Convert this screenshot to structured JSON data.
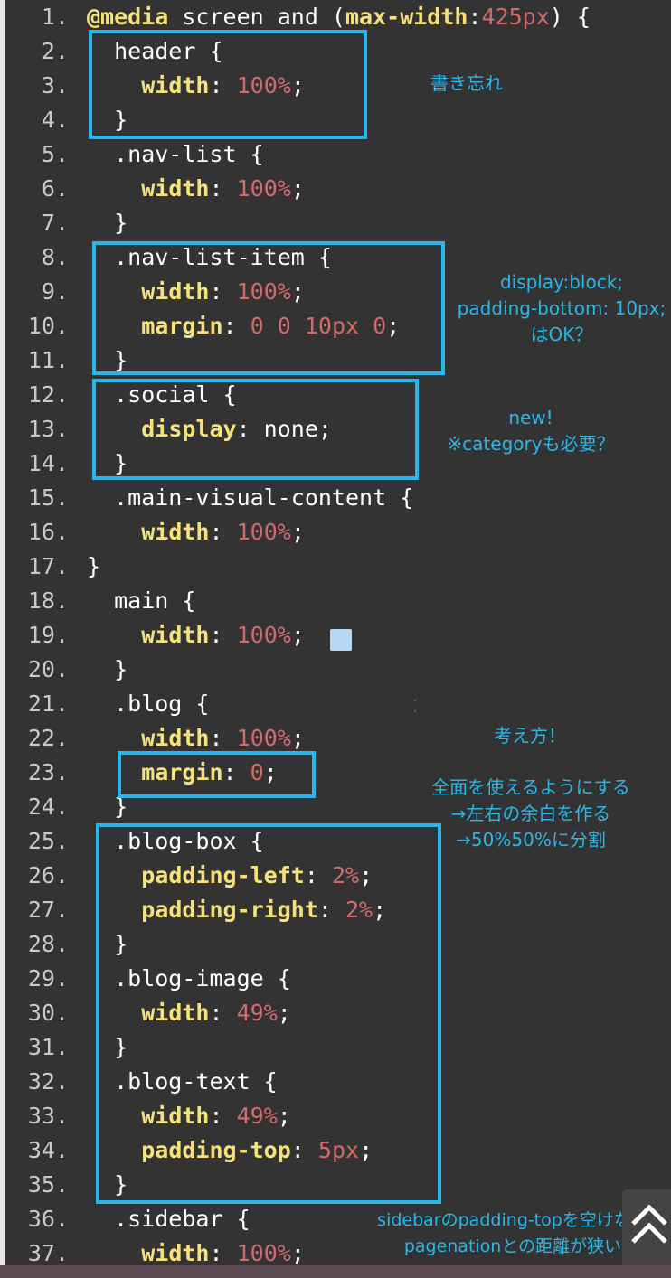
{
  "code_lines": [
    {
      "n": "1.",
      "tokens": [
        {
          "t": "@media",
          "c": "tok-at"
        },
        {
          "t": " screen and (",
          "c": "tok-pl"
        },
        {
          "t": "max-width",
          "c": "tok-kw"
        },
        {
          "t": ":",
          "c": "tok-pl"
        },
        {
          "t": "425px",
          "c": "tok-num"
        },
        {
          "t": ") {",
          "c": "tok-pl"
        }
      ]
    },
    {
      "n": "2.",
      "tokens": [
        {
          "t": "  header {",
          "c": "tok-pl"
        }
      ]
    },
    {
      "n": "3.",
      "tokens": [
        {
          "t": "    ",
          "c": "tok-pl"
        },
        {
          "t": "width",
          "c": "tok-kw"
        },
        {
          "t": ": ",
          "c": "tok-pl"
        },
        {
          "t": "100%",
          "c": "tok-num"
        },
        {
          "t": ";",
          "c": "tok-pl"
        }
      ]
    },
    {
      "n": "4.",
      "tokens": [
        {
          "t": "  }",
          "c": "tok-pl"
        }
      ]
    },
    {
      "n": "5.",
      "tokens": [
        {
          "t": "  .nav-list {",
          "c": "tok-pl"
        }
      ]
    },
    {
      "n": "6.",
      "tokens": [
        {
          "t": "    ",
          "c": "tok-pl"
        },
        {
          "t": "width",
          "c": "tok-kw"
        },
        {
          "t": ": ",
          "c": "tok-pl"
        },
        {
          "t": "100%",
          "c": "tok-num"
        },
        {
          "t": ";",
          "c": "tok-pl"
        }
      ]
    },
    {
      "n": "7.",
      "tokens": [
        {
          "t": "  }",
          "c": "tok-pl"
        }
      ]
    },
    {
      "n": "8.",
      "tokens": [
        {
          "t": "  .nav-list-item {",
          "c": "tok-pl"
        }
      ]
    },
    {
      "n": "9.",
      "tokens": [
        {
          "t": "    ",
          "c": "tok-pl"
        },
        {
          "t": "width",
          "c": "tok-kw"
        },
        {
          "t": ": ",
          "c": "tok-pl"
        },
        {
          "t": "100%",
          "c": "tok-num"
        },
        {
          "t": ";",
          "c": "tok-pl"
        }
      ]
    },
    {
      "n": "10.",
      "tokens": [
        {
          "t": "    ",
          "c": "tok-pl"
        },
        {
          "t": "margin",
          "c": "tok-kw"
        },
        {
          "t": ": ",
          "c": "tok-pl"
        },
        {
          "t": "0 0 10px 0",
          "c": "tok-num"
        },
        {
          "t": ";",
          "c": "tok-pl"
        }
      ]
    },
    {
      "n": "11.",
      "tokens": [
        {
          "t": "  }",
          "c": "tok-pl"
        }
      ]
    },
    {
      "n": "12.",
      "tokens": [
        {
          "t": "  .social {",
          "c": "tok-pl"
        }
      ]
    },
    {
      "n": "13.",
      "tokens": [
        {
          "t": "    ",
          "c": "tok-pl"
        },
        {
          "t": "display",
          "c": "tok-kw"
        },
        {
          "t": ": none;",
          "c": "tok-pl"
        }
      ]
    },
    {
      "n": "14.",
      "tokens": [
        {
          "t": "  }",
          "c": "tok-pl"
        }
      ]
    },
    {
      "n": "15.",
      "tokens": [
        {
          "t": "  .main-visual-content {",
          "c": "tok-pl"
        }
      ]
    },
    {
      "n": "16.",
      "tokens": [
        {
          "t": "    ",
          "c": "tok-pl"
        },
        {
          "t": "width",
          "c": "tok-kw"
        },
        {
          "t": ": ",
          "c": "tok-pl"
        },
        {
          "t": "100%",
          "c": "tok-num"
        },
        {
          "t": ";",
          "c": "tok-pl"
        }
      ]
    },
    {
      "n": "17.",
      "tokens": [
        {
          "t": "}",
          "c": "tok-pl"
        }
      ]
    },
    {
      "n": "18.",
      "tokens": [
        {
          "t": "  main {",
          "c": "tok-pl"
        }
      ]
    },
    {
      "n": "19.",
      "tokens": [
        {
          "t": "    ",
          "c": "tok-pl"
        },
        {
          "t": "width",
          "c": "tok-kw"
        },
        {
          "t": ": ",
          "c": "tok-pl"
        },
        {
          "t": "100%",
          "c": "tok-num"
        },
        {
          "t": ";",
          "c": "tok-pl"
        }
      ]
    },
    {
      "n": "20.",
      "tokens": [
        {
          "t": "  }",
          "c": "tok-pl"
        }
      ]
    },
    {
      "n": "21.",
      "tokens": [
        {
          "t": "  .blog {",
          "c": "tok-pl"
        }
      ]
    },
    {
      "n": "22.",
      "tokens": [
        {
          "t": "    ",
          "c": "tok-pl"
        },
        {
          "t": "width",
          "c": "tok-kw"
        },
        {
          "t": ": ",
          "c": "tok-pl"
        },
        {
          "t": "100%",
          "c": "tok-num"
        },
        {
          "t": ";",
          "c": "tok-pl"
        }
      ]
    },
    {
      "n": "23.",
      "tokens": [
        {
          "t": "    ",
          "c": "tok-pl"
        },
        {
          "t": "margin",
          "c": "tok-kw"
        },
        {
          "t": ": ",
          "c": "tok-pl"
        },
        {
          "t": "0",
          "c": "tok-num"
        },
        {
          "t": ";",
          "c": "tok-pl"
        }
      ]
    },
    {
      "n": "24.",
      "tokens": [
        {
          "t": "  }",
          "c": "tok-pl"
        }
      ]
    },
    {
      "n": "25.",
      "tokens": [
        {
          "t": "  .blog-box {",
          "c": "tok-pl"
        }
      ]
    },
    {
      "n": "26.",
      "tokens": [
        {
          "t": "    ",
          "c": "tok-pl"
        },
        {
          "t": "padding-left",
          "c": "tok-kw"
        },
        {
          "t": ": ",
          "c": "tok-pl"
        },
        {
          "t": "2%",
          "c": "tok-num"
        },
        {
          "t": ";",
          "c": "tok-pl"
        }
      ]
    },
    {
      "n": "27.",
      "tokens": [
        {
          "t": "    ",
          "c": "tok-pl"
        },
        {
          "t": "padding-right",
          "c": "tok-kw"
        },
        {
          "t": ": ",
          "c": "tok-pl"
        },
        {
          "t": "2%",
          "c": "tok-num"
        },
        {
          "t": ";",
          "c": "tok-pl"
        }
      ]
    },
    {
      "n": "28.",
      "tokens": [
        {
          "t": "  }",
          "c": "tok-pl"
        }
      ]
    },
    {
      "n": "29.",
      "tokens": [
        {
          "t": "  .blog-image {",
          "c": "tok-pl"
        }
      ]
    },
    {
      "n": "30.",
      "tokens": [
        {
          "t": "    ",
          "c": "tok-pl"
        },
        {
          "t": "width",
          "c": "tok-kw"
        },
        {
          "t": ": ",
          "c": "tok-pl"
        },
        {
          "t": "49%",
          "c": "tok-num"
        },
        {
          "t": ";",
          "c": "tok-pl"
        }
      ]
    },
    {
      "n": "31.",
      "tokens": [
        {
          "t": "  }",
          "c": "tok-pl"
        }
      ]
    },
    {
      "n": "32.",
      "tokens": [
        {
          "t": "  .blog-text {",
          "c": "tok-pl"
        }
      ]
    },
    {
      "n": "33.",
      "tokens": [
        {
          "t": "    ",
          "c": "tok-pl"
        },
        {
          "t": "width",
          "c": "tok-kw"
        },
        {
          "t": ": ",
          "c": "tok-pl"
        },
        {
          "t": "49%",
          "c": "tok-num"
        },
        {
          "t": ";",
          "c": "tok-pl"
        }
      ]
    },
    {
      "n": "34.",
      "tokens": [
        {
          "t": "    ",
          "c": "tok-pl"
        },
        {
          "t": "padding-top",
          "c": "tok-kw"
        },
        {
          "t": ": ",
          "c": "tok-pl"
        },
        {
          "t": "5px",
          "c": "tok-num"
        },
        {
          "t": ";",
          "c": "tok-pl"
        }
      ]
    },
    {
      "n": "35.",
      "tokens": [
        {
          "t": "  }",
          "c": "tok-pl"
        }
      ]
    },
    {
      "n": "36.",
      "tokens": [
        {
          "t": "  .sidebar {",
          "c": "tok-pl"
        }
      ]
    },
    {
      "n": "37.",
      "tokens": [
        {
          "t": "    ",
          "c": "tok-pl"
        },
        {
          "t": "width",
          "c": "tok-kw"
        },
        {
          "t": ": ",
          "c": "tok-pl"
        },
        {
          "t": "100%",
          "c": "tok-num"
        },
        {
          "t": ";",
          "c": "tok-pl"
        }
      ]
    }
  ],
  "annotations": {
    "note_header": "書き忘れ",
    "note_nav_item_1": "display:block;",
    "note_nav_item_2": "padding-bottom: 10px;",
    "note_nav_item_3": "はOK？",
    "note_social_1": "new!",
    "note_social_2": "※categoryも必要？",
    "note_blog": "考え方！",
    "note_blogbox_1": "全面を使えるようにする",
    "note_blogbox_2": "→左右の余白を作る",
    "note_blogbox_3": "→50%50%に分割",
    "note_sidebar_1": "sidebarのpadding-topを空けない",
    "note_sidebar_2": "pagenationとの距離が狭い"
  },
  "colors": {
    "background": "#333333",
    "annotation": "#29b6e8",
    "keyword": "#f5e27c",
    "number": "#d26b6b",
    "swatch": "#b7d7f7"
  },
  "icons": {
    "scroll_top": "chevron-double-up-icon"
  }
}
